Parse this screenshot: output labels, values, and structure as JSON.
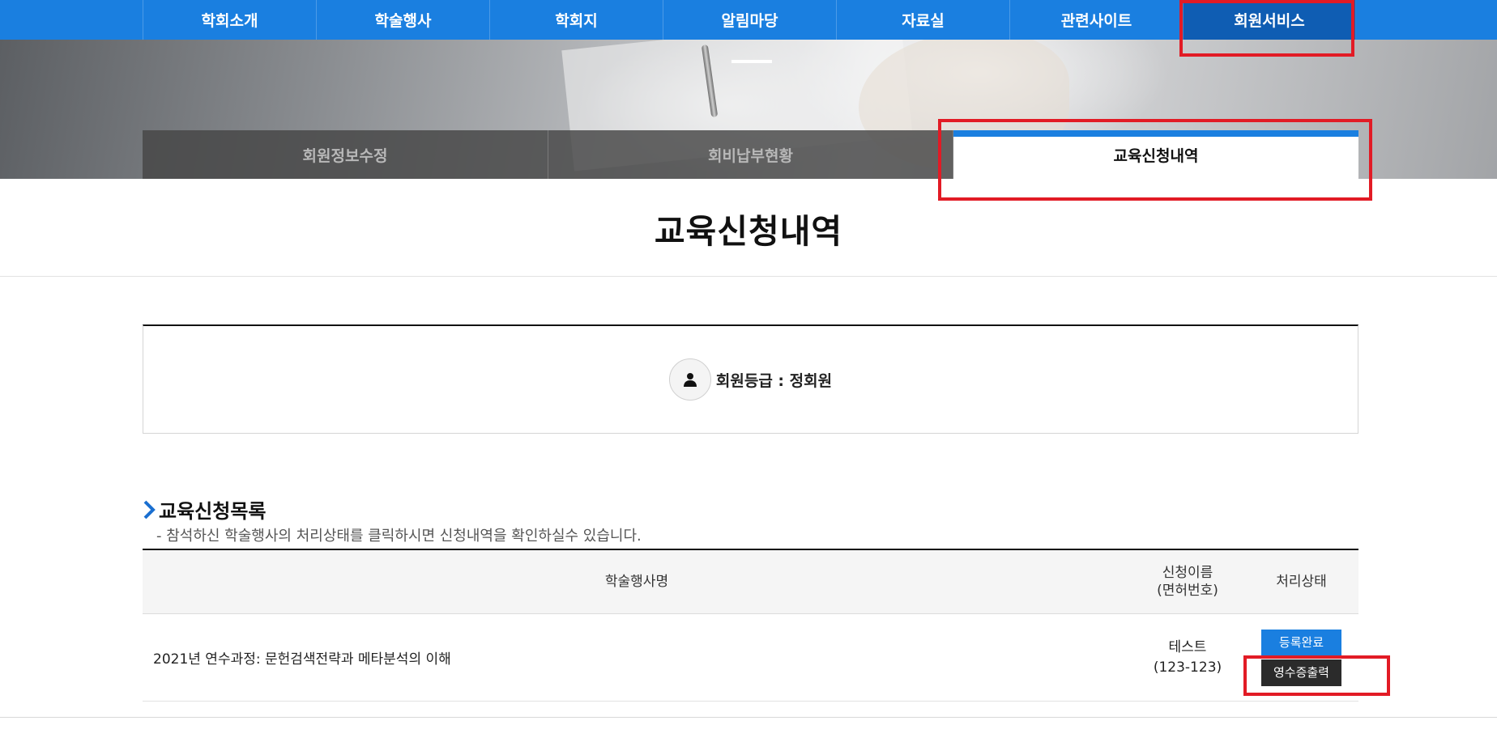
{
  "nav": {
    "items": [
      {
        "label": "학회소개"
      },
      {
        "label": "학술행사"
      },
      {
        "label": "학회지"
      },
      {
        "label": "알림마당"
      },
      {
        "label": "자료실"
      },
      {
        "label": "관련사이트"
      },
      {
        "label": "회원서비스",
        "active": true
      }
    ]
  },
  "subtabs": [
    {
      "label": "회원정보수정"
    },
    {
      "label": "회비납부현황"
    },
    {
      "label": "교육신청내역",
      "active": true
    }
  ],
  "page": {
    "title": "교육신청내역"
  },
  "member": {
    "grade_label": "회원등급 : 정회원",
    "icon": "user-icon"
  },
  "section": {
    "title": "교육신청목록",
    "description": "- 참석하신 학술행사의 처리상태를 클릭하시면 신청내역을 확인하실수 있습니다."
  },
  "table": {
    "headers": {
      "event_name": "학술행사명",
      "applicant_line1": "신청이름",
      "applicant_line2": "(면허번호)",
      "status": "처리상태"
    },
    "rows": [
      {
        "event_name": "2021년 연수과정: 문헌검색전략과 메타분석의 이해",
        "applicant_name": "테스트",
        "license_no": "(123-123)",
        "status_button": "등록완료",
        "receipt_button": "영수증출력"
      }
    ]
  },
  "colors": {
    "primary": "#1a7fe0",
    "nav_active": "#0f5db3",
    "annotation": "#e21b25",
    "dark_button": "#2b2b2b"
  }
}
